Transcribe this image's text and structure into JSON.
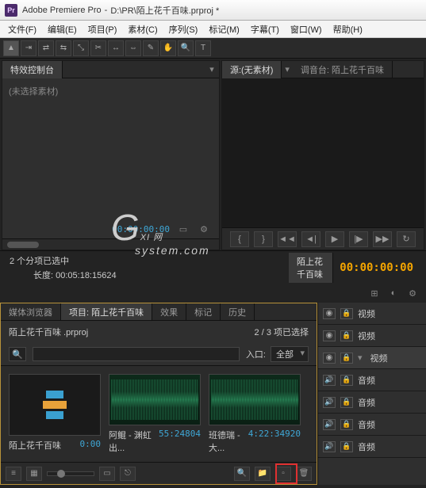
{
  "title": {
    "app": "Adobe Premiere Pro",
    "path": "D:\\PR\\陌上花千百味.prproj *"
  },
  "menu": [
    "文件(F)",
    "编辑(E)",
    "项目(P)",
    "素材(C)",
    "序列(S)",
    "标记(M)",
    "字幕(T)",
    "窗口(W)",
    "帮助(H)"
  ],
  "panels": {
    "effectControl": "特效控制台",
    "noClip": "(未选择素材)",
    "source": "源:(无素材)",
    "audioMixer": "调音台: 陌上花千百味"
  },
  "timecode": {
    "monitor": "00:00:00:00",
    "sequence": "00:00:00:00"
  },
  "selection": {
    "count": "2 个分项已选中",
    "len": "长度: 00:05:18:15624"
  },
  "sequence": {
    "name": "陌上花千百味"
  },
  "projectTabs": {
    "browser": "媒体浏览器",
    "project": "项目: 陌上花千百味",
    "effects": "效果",
    "markers": "标记",
    "history": "历史"
  },
  "project": {
    "file": "陌上花千百味 .prproj",
    "status": "2 / 3 项已选择",
    "inlet": "入口:",
    "inletVal": "全部",
    "clips": [
      {
        "name": "陌上花千百味",
        "dur": "0:00",
        "type": "seq"
      },
      {
        "name": "阿鲲 - 渊虹出...",
        "dur": "55:24804",
        "type": "audio"
      },
      {
        "name": "班德瑞 - 大...",
        "dur": "4:22:34920",
        "type": "audio"
      }
    ]
  },
  "tracks": [
    {
      "name": "视频",
      "type": "v"
    },
    {
      "name": "视频",
      "type": "v"
    },
    {
      "name": "视频",
      "type": "v",
      "hl": true
    },
    {
      "name": "音频",
      "type": "a"
    },
    {
      "name": "音频",
      "type": "a"
    },
    {
      "name": "音频",
      "type": "a"
    },
    {
      "name": "音频",
      "type": "a"
    }
  ],
  "watermark": {
    "g": "G",
    "rest": "XI 网",
    "sub": "system.com"
  }
}
